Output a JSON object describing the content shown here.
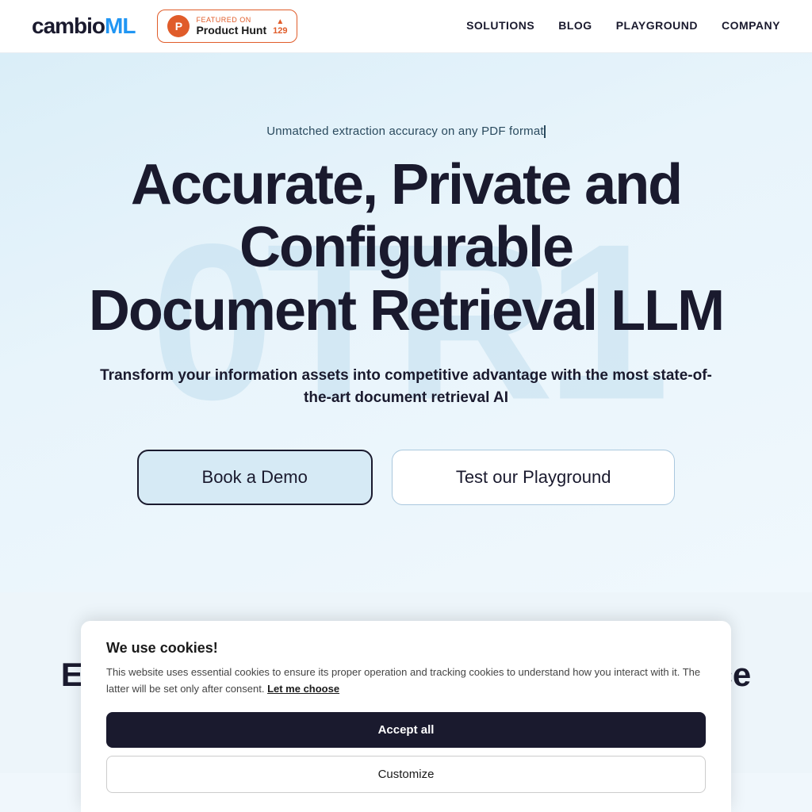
{
  "logo": {
    "text_start": "cambio",
    "text_end": "ML"
  },
  "product_hunt": {
    "featured_label": "FEATURED ON",
    "name": "Product Hunt",
    "arrow": "▲",
    "count": "129"
  },
  "nav": {
    "links": [
      {
        "id": "solutions",
        "label": "SOLUTIONS"
      },
      {
        "id": "blog",
        "label": "BLOG"
      },
      {
        "id": "playground",
        "label": "PLAYGROUND"
      },
      {
        "id": "company",
        "label": "COMPANY"
      }
    ]
  },
  "hero": {
    "tagline": "Unmatched extraction accuracy on any PDF format",
    "watermark": "0TR1",
    "title_line1": "Accurate, Private and Configurable",
    "title_line2": "Document Retrieval LLM",
    "subtitle": "Transform your information assets into competitive advantage with the most state-of-the-art document retrieval AI",
    "btn_demo": "Book a Demo",
    "btn_playground": "Test our Playground"
  },
  "section2": {
    "title": "Extract key information with full confidence"
  },
  "cookie": {
    "title": "We use cookies!",
    "body": "This website uses essential cookies to ensure its proper operation and tracking cookies to understand how you interact with it. The latter will be set only after consent.",
    "link_text": "Let me choose",
    "btn_accept": "Accept all",
    "btn_customize": "Customize"
  }
}
